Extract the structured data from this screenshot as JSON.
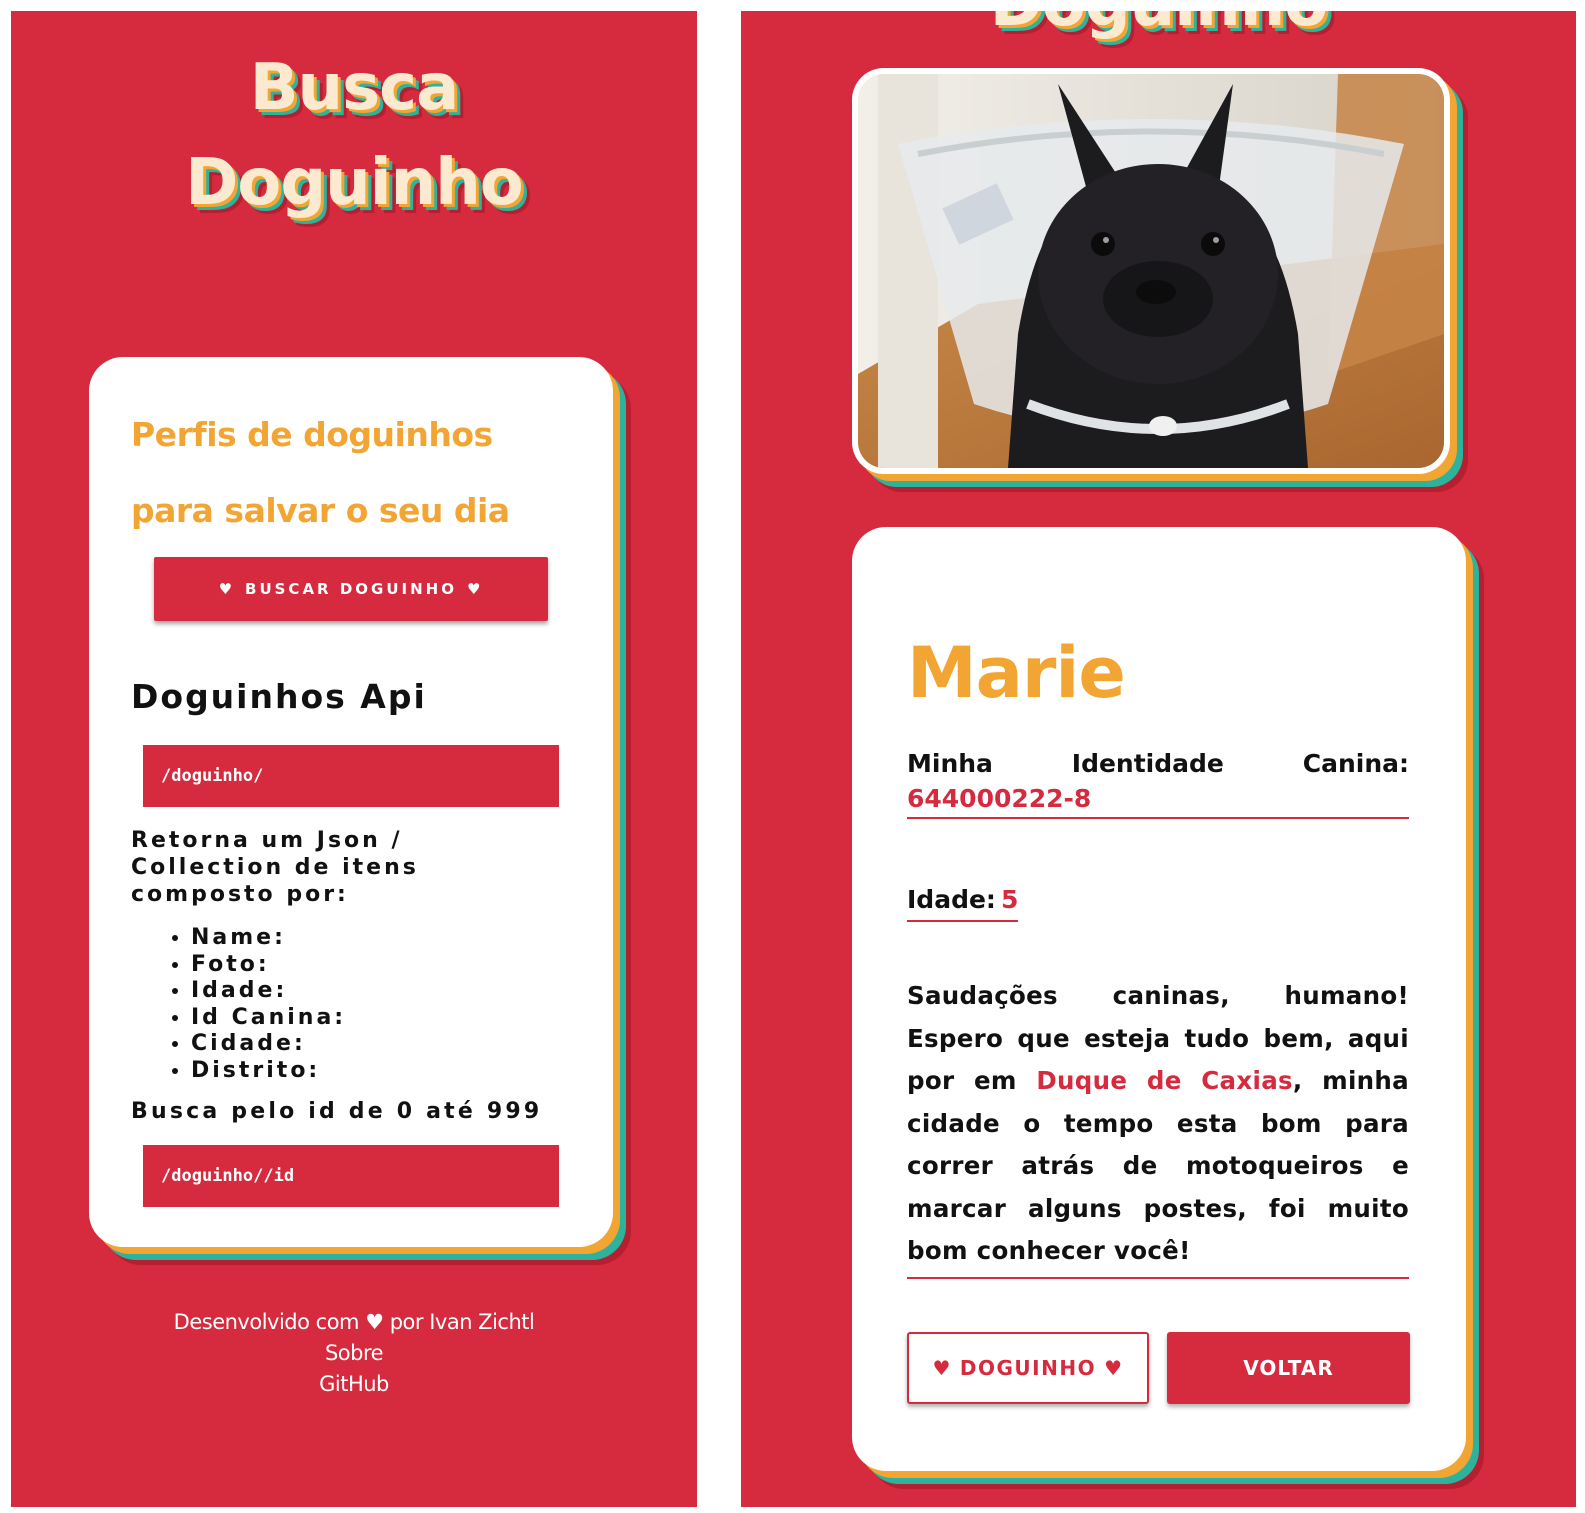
{
  "left_screen": {
    "title_line1": "Busca",
    "title_line2": "Doguinho",
    "card": {
      "tagline": "Perfis de doguinhos para salvar o seu dia",
      "search_button": "BUSCAR DOGUINHO",
      "api_title": "Doguinhos Api",
      "endpoint_list": "/doguinho/",
      "description": "Retorna um Json / Collection de itens composto por:",
      "fields": [
        "Name:",
        "Foto:",
        "Idade:",
        "Id Canina:",
        "Cidade:",
        "Distrito:"
      ],
      "search_by_id_text": "Busca pelo id de 0 até 999",
      "endpoint_id": "/doguinho//id"
    },
    "footer": {
      "prefix": "Desenvolvido com",
      "suffix": "por Ivan Zichtl",
      "about_link": "Sobre",
      "github_link": "GitHub"
    }
  },
  "right_screen": {
    "title_partial": "Doguinho",
    "profile": {
      "photo_icon": "french-bulldog-photo",
      "name": "Marie",
      "id_label_words": [
        "Minha",
        "Identidade",
        "Canina:"
      ],
      "id_value": "644000222-8",
      "age_label": "Idade:",
      "age_value": "5",
      "bio_part1": "Saudações caninas, humano! Espero que esteja tudo bem, aqui por em ",
      "bio_city": "Duque de Caxias",
      "bio_part2": ", minha cidade o tempo esta bom para correr atrás de motoqueiros e marcar alguns postes, foi muito bom conhecer você!",
      "dog_button": "DOGUINHO",
      "back_button": "VOLTAR"
    }
  },
  "colors": {
    "primary_red": "#d62a3e",
    "accent_orange": "#f2a533",
    "accent_teal": "#2db39b",
    "title_cream": "#fbead0"
  },
  "icons": [
    "heart-icon"
  ]
}
